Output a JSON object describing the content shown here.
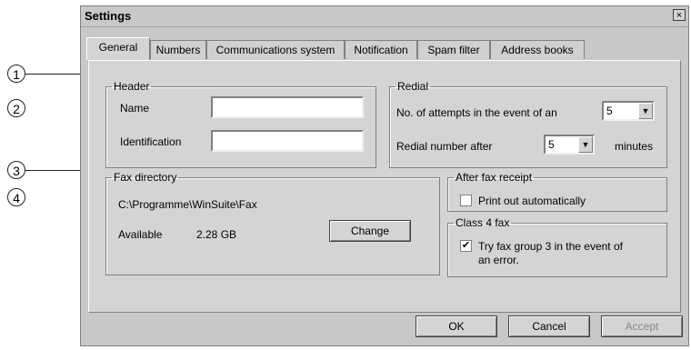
{
  "callouts": [
    "1",
    "2",
    "3",
    "4"
  ],
  "window": {
    "title": "Settings",
    "close_glyph": "×"
  },
  "tabs": [
    {
      "label": "General",
      "active": true
    },
    {
      "label": "Numbers"
    },
    {
      "label": "Communications system"
    },
    {
      "label": "Notification"
    },
    {
      "label": "Spam filter"
    },
    {
      "label": "Address books"
    }
  ],
  "header_group": {
    "legend": "Header",
    "name_label": "Name",
    "name_value": "",
    "identification_label": "Identification",
    "identification_value": ""
  },
  "redial_group": {
    "legend": "Redial",
    "attempts_label": "No. of attempts in the event of an",
    "attempts_value": "5",
    "redial_after_label": "Redial number after",
    "redial_after_value": "5",
    "minutes_label": "minutes"
  },
  "fax_directory_group": {
    "legend": "Fax directory",
    "path": "C:\\Programme\\WinSuite\\Fax",
    "available_label": "Available",
    "available_value": "2.28 GB",
    "change_button": "Change"
  },
  "after_fax_group": {
    "legend": "After fax receipt",
    "print_label": "Print out automatically",
    "print_checked": false
  },
  "class4_group": {
    "legend": "Class 4 fax",
    "try_label_line1": "Try fax group 3 in the event of",
    "try_label_line2": "an error.",
    "try_checked": true,
    "check_glyph": "✔"
  },
  "footer": {
    "ok": "OK",
    "cancel": "Cancel",
    "accept": "Accept"
  },
  "icons": {
    "dropdown_arrow": "▼"
  }
}
